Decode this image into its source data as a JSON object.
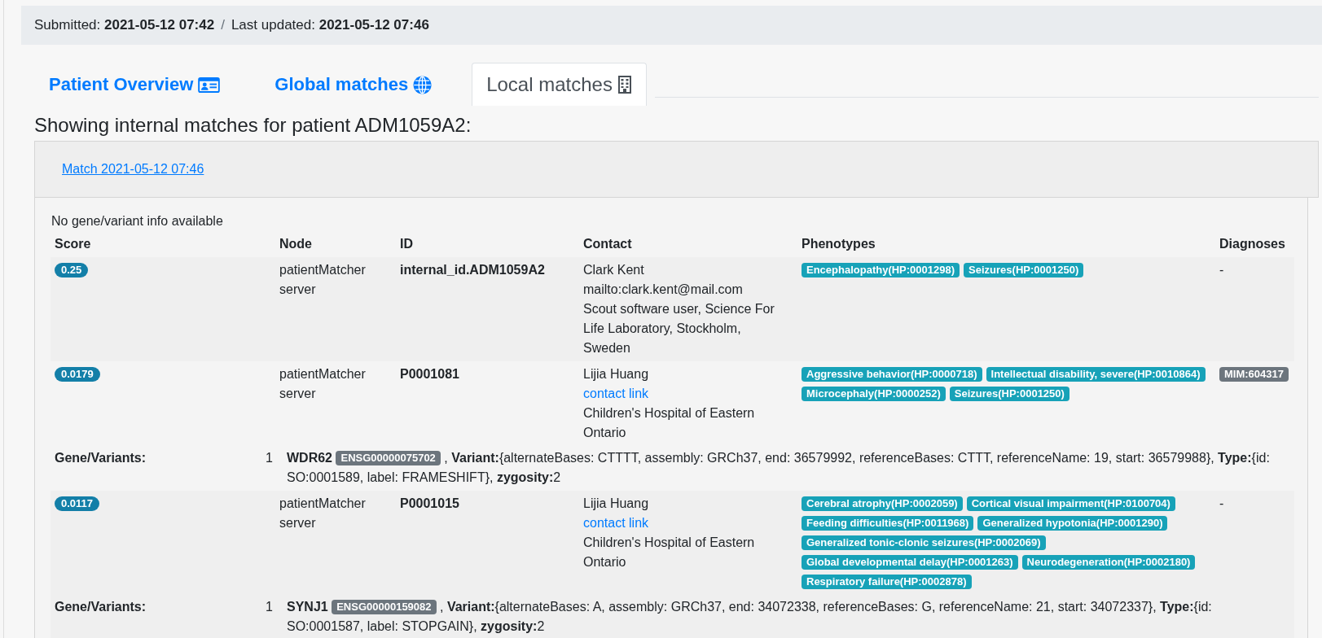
{
  "timestamp_bar": {
    "items": [
      {
        "label": "Submitted:",
        "value": "2021-05-12 07:42"
      },
      {
        "label": "Last updated:",
        "value": "2021-05-12 07:46"
      }
    ],
    "separator": "/"
  },
  "tabs": [
    {
      "label": "Patient Overview",
      "selected": false
    },
    {
      "label": "Global matches",
      "selected": false
    },
    {
      "label": "Local matches",
      "selected": true
    }
  ],
  "heading": "Showing internal matches for patient ADM1059A2:",
  "match_card": {
    "title": "Match 2021-05-12 07:46",
    "note": "No gene/variant info available",
    "columns": [
      "Score",
      "Node",
      "ID",
      "Contact",
      "Phenotypes",
      "Diagnoses"
    ],
    "rows": [
      {
        "score": "0.25",
        "node": "patientMatcher server",
        "id": "internal_id.ADM1059A2",
        "contact": [
          {
            "kind": "name",
            "text": "Clark Kent"
          },
          {
            "kind": "email",
            "text": "mailto:clark.kent@mail.com"
          },
          {
            "kind": "institution",
            "text": "Scout software user, Science For Life Laboratory, Stockholm, Sweden"
          }
        ],
        "phenotypes": [
          "Encephalopathy(HP:0001298)",
          "Seizures(HP:0001250)"
        ],
        "diagnoses": [
          {
            "kind": "text",
            "text": "-"
          }
        ]
      },
      {
        "score": "0.0179",
        "node": "patientMatcher server",
        "id": "P0001081",
        "contact": [
          {
            "kind": "name",
            "text": "Lijia Huang"
          },
          {
            "kind": "link",
            "text": "contact link"
          },
          {
            "kind": "institution",
            "text": "Children's Hospital of Eastern Ontario"
          }
        ],
        "phenotypes": [
          "Aggressive behavior(HP:0000718)",
          "Intellectual disability, severe(HP:0010864)",
          "Microcephaly(HP:0000252)",
          "Seizures(HP:0001250)"
        ],
        "diagnoses": [
          {
            "kind": "badge",
            "text": "MIM:604317"
          }
        ],
        "gene_variants": {
          "label": "Gene/Variants:",
          "items": [
            {
              "number": "1",
              "gene": "WDR62",
              "gene_id": "ENSG00000075702",
              "details": ", **Variant:**{alternateBases: CTTTT, assembly: GRCh37, end: 36579992, referenceBases: CTTT, referenceName: 19, start: 36579988}, **Type:**{id: SO:0001589, label: FRAMESHIFT}, **zygosity:**2"
            }
          ]
        }
      },
      {
        "score": "0.0117",
        "node": "patientMatcher server",
        "id": "P0001015",
        "contact": [
          {
            "kind": "name",
            "text": "Lijia Huang"
          },
          {
            "kind": "link",
            "text": "contact link"
          },
          {
            "kind": "institution",
            "text": "Children's Hospital of Eastern Ontario"
          }
        ],
        "phenotypes": [
          "Cerebral atrophy(HP:0002059)",
          "Cortical visual impairment(HP:0100704)",
          "Feeding difficulties(HP:0011968)",
          "Generalized hypotonia(HP:0001290)",
          "Generalized tonic-clonic seizures(HP:0002069)",
          "Global developmental delay(HP:0001263)",
          "Neurodegeneration(HP:0002180)",
          "Respiratory failure(HP:0002878)"
        ],
        "diagnoses": [
          {
            "kind": "text",
            "text": "-"
          }
        ],
        "gene_variants": {
          "label": "Gene/Variants:",
          "items": [
            {
              "number": "1",
              "gene": "SYNJ1",
              "gene_id": "ENSG00000159082",
              "details": ", **Variant:**{alternateBases: A, assembly: GRCh37, end: 34072338, referenceBases: G, referenceName: 21, start: 34072337}, **Type:**{id: SO:0001587, label: STOPGAIN}, **zygosity:**2"
            }
          ]
        }
      }
    ]
  }
}
